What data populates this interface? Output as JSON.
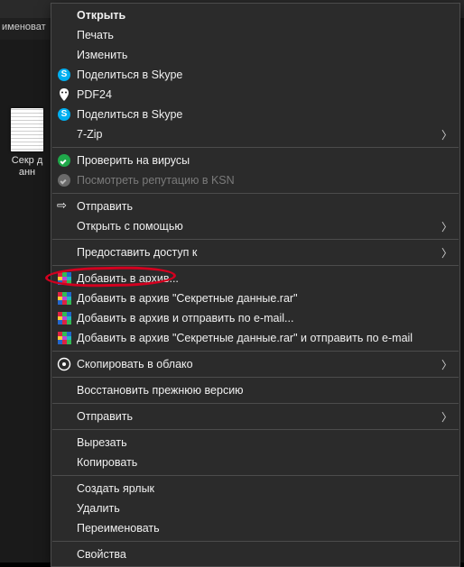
{
  "background": {
    "partial_toolbar_text": "именоват",
    "file_label": "Секр данн"
  },
  "menu": {
    "open": "Открыть",
    "print": "Печать",
    "edit": "Изменить",
    "skype_share_1": "Поделиться в Skype",
    "pdf24": "PDF24",
    "skype_share_2": "Поделиться в Skype",
    "seven_zip": "7-Zip",
    "virus_check": "Проверить на вирусы",
    "ksn": "Посмотреть репутацию в KSN",
    "send": "Отправить",
    "open_with": "Открыть с помощью",
    "grant_access": "Предоставить доступ к",
    "rar_add": "Добавить в архив...",
    "rar_add_named": "Добавить в архив \"Секретные данные.rar\"",
    "rar_email": "Добавить в архив и отправить по e-mail...",
    "rar_named_email": "Добавить в архив \"Секретные данные.rar\" и отправить по e-mail",
    "copy_cloud": "Скопировать в облако",
    "restore": "Восстановить прежнюю версию",
    "send_to": "Отправить",
    "cut": "Вырезать",
    "copy": "Копировать",
    "shortcut": "Создать ярлык",
    "delete": "Удалить",
    "rename": "Переименовать",
    "properties": "Свойства"
  }
}
